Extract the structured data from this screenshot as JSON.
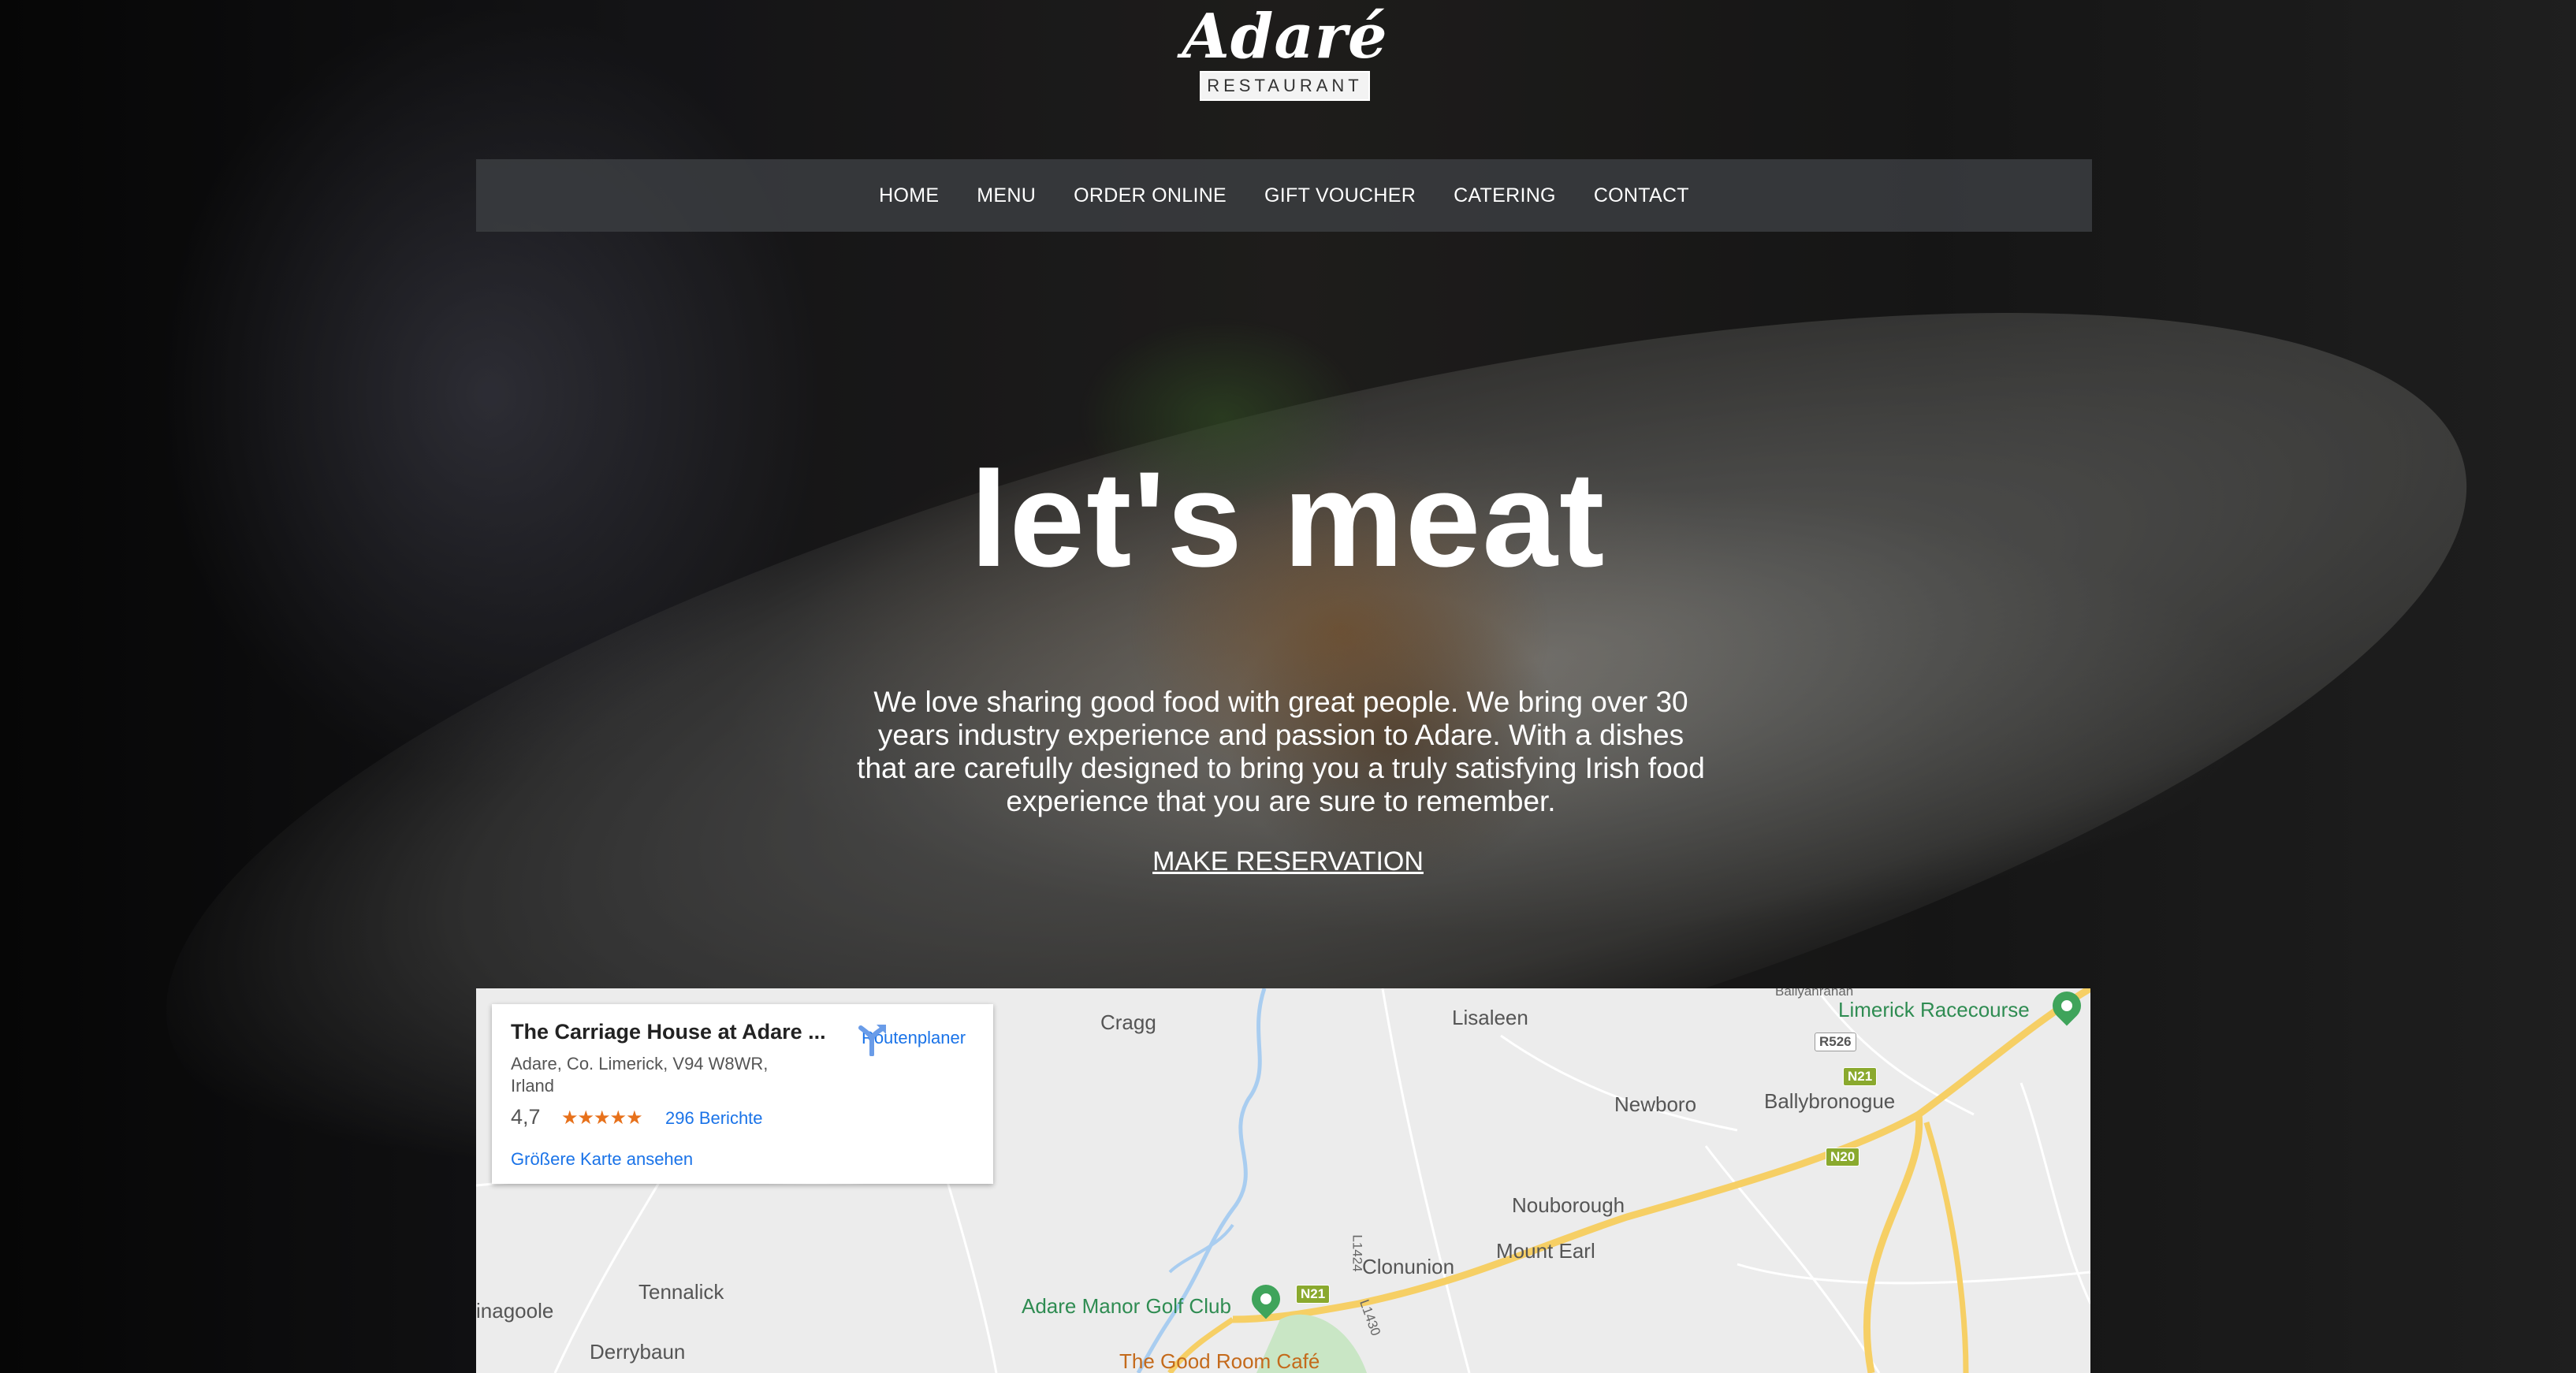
{
  "logo": {
    "script": "Adaré",
    "sub": "RESTAURANT"
  },
  "nav": {
    "items": [
      "HOME",
      "MENU",
      "ORDER ONLINE",
      "GIFT VOUCHER",
      "CATERING",
      "CONTACT"
    ]
  },
  "hero": {
    "headline": "let's meat",
    "intro": "We love sharing good food with great people. We bring over 30 years industry experience and passion to Adare. With a dishes that are carefully designed to bring you a truly satisfying Irish food experience that you are sure to remember.",
    "cta": "MAKE RESERVATION"
  },
  "map": {
    "card": {
      "title": "The Carriage House at Adare ...",
      "address": "Adare, Co. Limerick, V94 W8WR, Irland",
      "rating": "4,7",
      "stars": "★★★★★",
      "reviews": "296 Berichte",
      "larger_map": "Größere Karte ansehen",
      "directions": "Routenplaner"
    },
    "places": {
      "cragg": "Cragg",
      "lisaleen": "Lisaleen",
      "racecourse": "Limerick Racecourse",
      "newboro": "Newboro",
      "ballybronogue": "Ballybronogue",
      "nouborough": "Nouborough",
      "clonunion": "Clonunion",
      "mount_earl": "Mount Earl",
      "tennalick": "Tennalick",
      "inagoole": "inagoole",
      "derrybaun": "Derrybaun",
      "golf": "Adare Manor Golf Club",
      "cafe": "The Good Room Café",
      "ballyanrahan": "Ballyanrahan"
    },
    "roads": {
      "r526": "R526",
      "n21_top": "N21",
      "n20": "N20",
      "n21_bottom": "N21",
      "l1424": "L1424",
      "l1430": "L1430"
    }
  },
  "colors": {
    "nav_bg": "#3c3e42",
    "link_blue": "#1a73e8",
    "star_orange": "#e7711b",
    "pin_green": "#3fa45b",
    "road_yellow": "#f6cf65"
  }
}
